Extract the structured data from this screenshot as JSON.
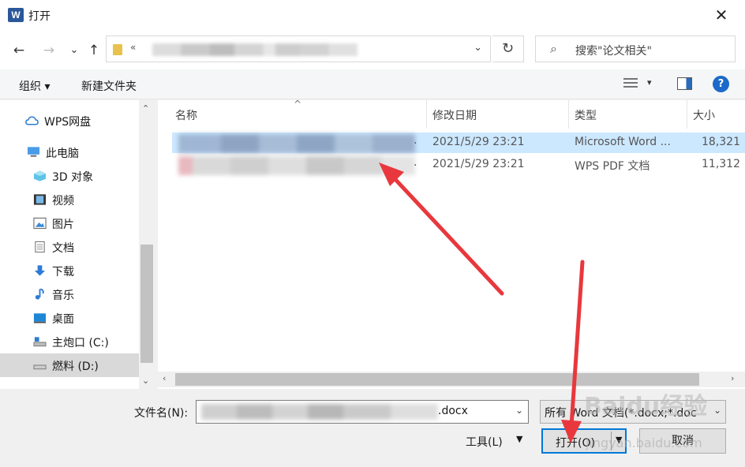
{
  "window": {
    "title": "打开",
    "app_icon": "W",
    "close": "✕"
  },
  "nav": {
    "back": "←",
    "forward": "→",
    "recent": "⌄",
    "up": "↑",
    "address_prefix": "«",
    "address_dropdown": "⌄",
    "refresh": "↻",
    "search_placeholder": "搜索\"论文相关\"",
    "search_icon": "⌕"
  },
  "toolbar": {
    "organize": "组织 ▾",
    "new_folder": "新建文件夹",
    "help": "?",
    "view_dropdown": "▾"
  },
  "sidebar": {
    "items": [
      {
        "label": "WPS网盘",
        "icon": "cloud-icon"
      },
      {
        "label": "此电脑",
        "icon": "computer-icon"
      },
      {
        "label": "3D 对象",
        "icon": "cube-icon"
      },
      {
        "label": "视频",
        "icon": "film-icon"
      },
      {
        "label": "图片",
        "icon": "picture-icon"
      },
      {
        "label": "文档",
        "icon": "document-icon"
      },
      {
        "label": "下载",
        "icon": "download-icon"
      },
      {
        "label": "音乐",
        "icon": "music-icon"
      },
      {
        "label": "桌面",
        "icon": "desktop-icon"
      },
      {
        "label": "主炮口 (C:)",
        "icon": "drive-c-icon"
      },
      {
        "label": "燃料 (D:)",
        "icon": "drive-d-icon"
      }
    ],
    "scroll_up": "⌃",
    "scroll_down": "⌄"
  },
  "files": {
    "columns": [
      "名称",
      "修改日期",
      "类型",
      "大小"
    ],
    "sort_caret": "^",
    "rows": [
      {
        "date": "2021/5/29 23:21",
        "type": "Microsoft Word ...",
        "size": "18,321",
        "dot": "."
      },
      {
        "date": "2021/5/29 23:21",
        "type": "WPS PDF 文档",
        "size": "11,312",
        "dot": "."
      }
    ],
    "scroll_left": "‹",
    "scroll_right": "›"
  },
  "bottom": {
    "filename_label": "文件名(N):",
    "filename_ext": ".docx",
    "filename_dropdown": "⌄",
    "filter_text": "所有 Word 文档(*.docx;*.doc",
    "filter_dropdown": "⌄",
    "tools": "工具(L)",
    "tools_dropdown": "▼",
    "open": "打开(O)",
    "open_dropdown": "▼",
    "cancel": "取消"
  },
  "watermark": {
    "text": "Baidu经验",
    "url": "jingyan.baidu.com"
  },
  "colors": {
    "accent": "#0078d7",
    "selection": "#cce8ff",
    "arrow": "#e8383d"
  }
}
